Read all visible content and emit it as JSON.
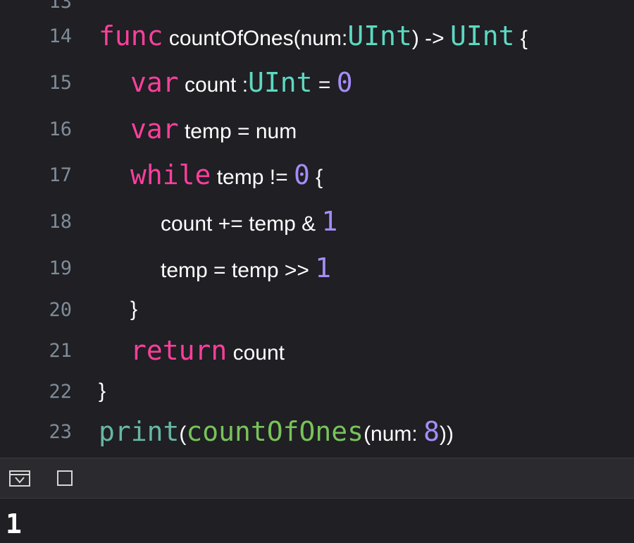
{
  "editor": {
    "lines": [
      {
        "no": "13"
      },
      {
        "no": "14",
        "t": [
          "func",
          " countOfOnes(num:",
          "UInt",
          ") -> ",
          "UInt",
          " {"
        ]
      },
      {
        "no": "15",
        "t": [
          "var",
          " count :",
          "UInt",
          " = ",
          "0"
        ]
      },
      {
        "no": "16",
        "t": [
          "var",
          " temp = num"
        ]
      },
      {
        "no": "17",
        "t": [
          "while",
          " temp != ",
          "0",
          " {"
        ]
      },
      {
        "no": "18",
        "t": [
          "count += temp & ",
          "1"
        ]
      },
      {
        "no": "19",
        "t": [
          "temp = temp >> ",
          "1"
        ]
      },
      {
        "no": "20",
        "t": [
          "}"
        ]
      },
      {
        "no": "21",
        "t": [
          "return",
          " count"
        ]
      },
      {
        "no": "22",
        "t": [
          "}"
        ]
      },
      {
        "no": "23",
        "t": [
          "print",
          "(",
          "countOfOnes",
          "(num: ",
          "8",
          "))"
        ]
      }
    ]
  },
  "console": {
    "toggle_icon": "hide-debug-area-icon",
    "clear_icon": "clear-console-icon",
    "output": "1"
  }
}
